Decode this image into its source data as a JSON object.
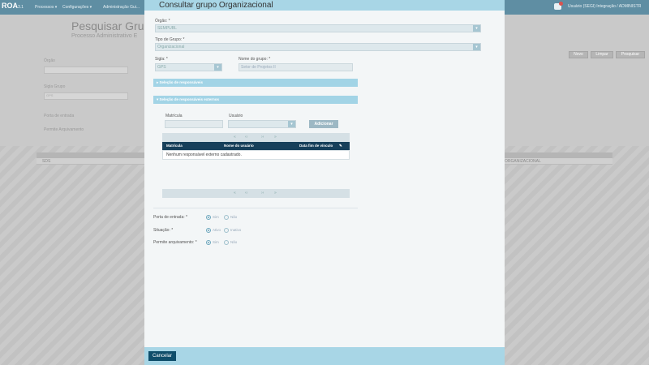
{
  "background": {
    "logo": "ROA",
    "logo_sub": "",
    "version": "3.1",
    "menu": [
      "Processos ▾",
      "Configurações ▾",
      "Administração Gui..."
    ],
    "user_text": "Usuário (SEGI) Integração / ADMINISTR",
    "title": "Pesquisar Grup",
    "subtitle": "Processo Administrativo E",
    "labels": {
      "orgao": "Órgão",
      "sigla_grupo": "Sigla Grupo",
      "porta": "Porta de entrada",
      "permite": "Permite Arquivamento"
    },
    "sigla_value": "GPS",
    "buttons": [
      "Novo",
      "Limpar",
      "Pesquisar"
    ],
    "table_cells": {
      "left": "SDS",
      "right": "ORGANIZACIONAL"
    }
  },
  "modal": {
    "title": "Consultar grupo Organizacional",
    "orgao_label": "Órgão: *",
    "orgao_value": "SEMPUBL",
    "tipo_label": "Tipo de Grupo: *",
    "tipo_value": "Organizacional",
    "sigla_label": "Sigla: *",
    "sigla_value": "GPS",
    "nome_label": "Nome do grupo: *",
    "nome_value": "Setor de Projetos II",
    "section_responsaveis": "▸ Seleção de responsáveis",
    "section_externos": "▾ Seleção de responsáveis externos",
    "matricula_label": "Matrícula",
    "usuario_label": "Usuário",
    "adicionar": "Adicionar",
    "pager_symbols": [
      "«",
      "‹‹",
      "››",
      "»"
    ],
    "table_headers": [
      "Matrícula",
      "Nome do usuário",
      "Data fim de vínculo"
    ],
    "empty_row": "Nenhum responsável externo cadastrado.",
    "porta_label": "Porta de entrada: *",
    "situacao_label": "Situação: *",
    "permite_label": "Permite arquivamento: *",
    "sim": "Sim",
    "nao": "Não",
    "ativo": "Ativo",
    "inativo": "Inativo",
    "cancel": "Cancelar"
  },
  "colors": {
    "header": "#a8d6e6",
    "table_head": "#163f5a",
    "cancel": "#0f4e6b"
  },
  "icons": {
    "select": "chevron-down-icon",
    "edit": "pencil-icon",
    "notification": "bell-icon"
  }
}
